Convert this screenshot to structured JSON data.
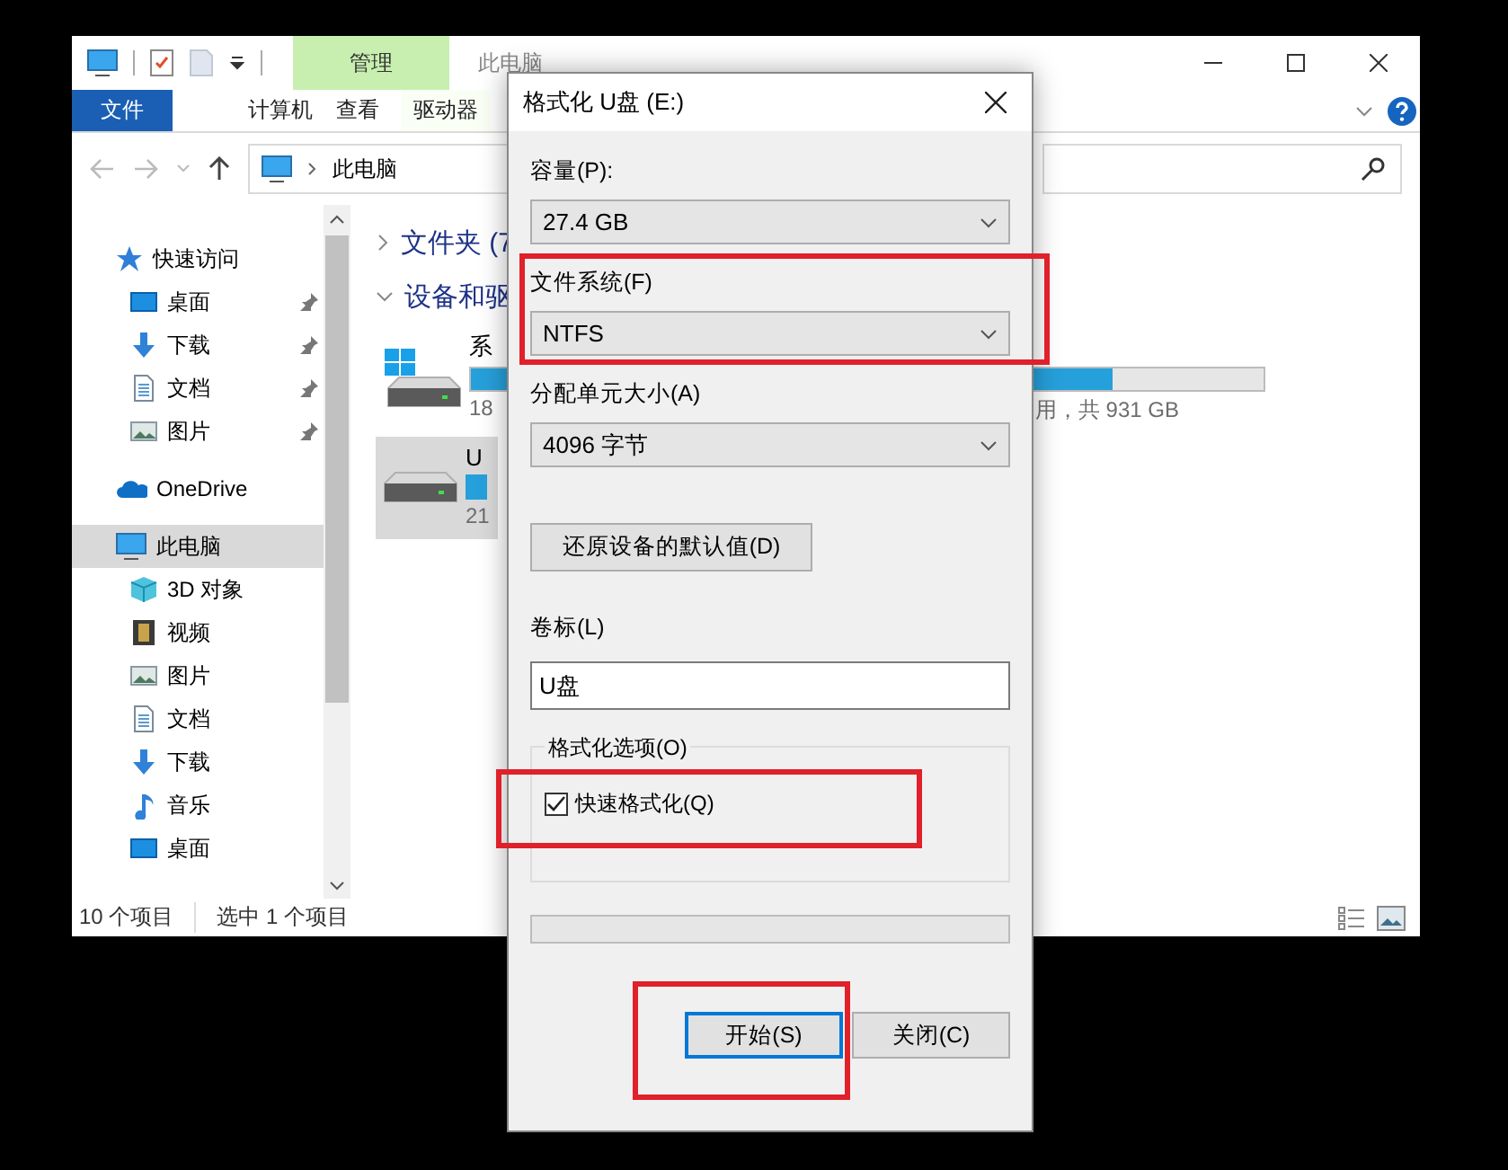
{
  "explorer": {
    "title": "此电脑",
    "context_tab": "管理",
    "ribbon_tabs": [
      {
        "label": "文件",
        "kind": "file"
      },
      {
        "label": "计算机",
        "kind": "tab"
      },
      {
        "label": "查看",
        "kind": "tab"
      },
      {
        "label": "驱动器",
        "kind": "context"
      }
    ],
    "address": "此电脑",
    "nav": [
      {
        "label": "快速访问",
        "kind": "star",
        "selected": false,
        "children": [
          {
            "label": "桌面",
            "kind": "desktop",
            "pinned": true,
            "selected": false
          },
          {
            "label": "下载",
            "kind": "download",
            "pinned": true,
            "selected": false
          },
          {
            "label": "文档",
            "kind": "document",
            "pinned": true,
            "selected": false
          },
          {
            "label": "图片",
            "kind": "pictures",
            "pinned": true,
            "selected": false
          }
        ]
      },
      {
        "label": "OneDrive",
        "kind": "cloud",
        "selected": false
      },
      {
        "label": "此电脑",
        "kind": "pc",
        "selected": true,
        "children": [
          {
            "label": "3D 对象",
            "kind": "cube",
            "selected": false
          },
          {
            "label": "视频",
            "kind": "video",
            "selected": false
          },
          {
            "label": "图片",
            "kind": "pictures",
            "selected": false
          },
          {
            "label": "文档",
            "kind": "document",
            "selected": false
          },
          {
            "label": "下载",
            "kind": "download",
            "selected": false
          },
          {
            "label": "音乐",
            "kind": "music",
            "selected": false
          },
          {
            "label": "桌面",
            "kind": "desktop",
            "selected": false
          }
        ]
      }
    ],
    "groups": [
      {
        "label": "文件夹 (7",
        "expanded": false
      },
      {
        "label": "设备和驱",
        "expanded": true
      }
    ],
    "drives": [
      {
        "name": "系",
        "kind": "system",
        "selected": false,
        "level": 0.81,
        "size": "18",
        "free_total": "用，共 931 GB"
      },
      {
        "name": "U",
        "kind": "usb",
        "selected": true,
        "size": "21"
      }
    ],
    "status": {
      "items": "10 个项目",
      "selection": "选中 1 个项目"
    }
  },
  "dialog": {
    "title": "格式化 U盘 (E:)",
    "fields": [
      {
        "label": "容量(P):",
        "value": "27.4 GB",
        "highlighted": false
      },
      {
        "label": "文件系统(F)",
        "value": "NTFS",
        "highlighted": true
      },
      {
        "label": "分配单元大小(A)",
        "value": "4096 字节",
        "highlighted": false
      }
    ],
    "restore_button": "还原设备的默认值(D)",
    "volume_label": {
      "label": "卷标(L)",
      "value": "U盘"
    },
    "options": {
      "title": "格式化选项(O)",
      "checkbox": {
        "label": "快速格式化(Q)",
        "checked": true,
        "highlighted": true
      }
    },
    "progress": {
      "level": 0
    },
    "buttons": [
      {
        "label": "开始(S)",
        "default": true,
        "highlighted": true
      },
      {
        "label": "关闭(C)",
        "default": false,
        "highlighted": false
      }
    ]
  }
}
